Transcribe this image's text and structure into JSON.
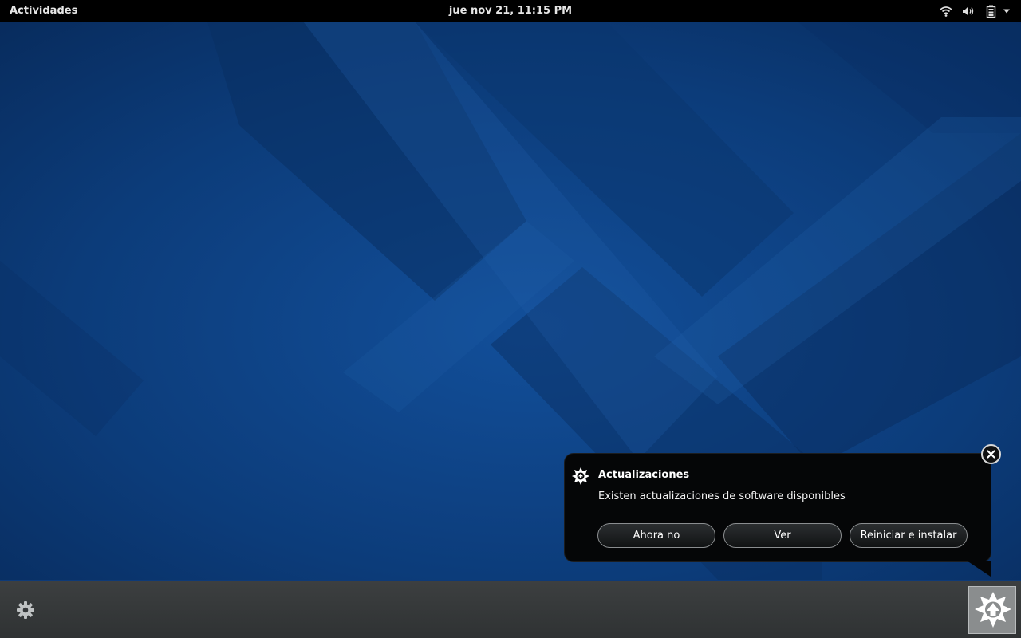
{
  "topbar": {
    "activities_label": "Actividades",
    "clock": "jue nov 21, 11:15 PM",
    "icons": [
      "wifi-icon",
      "volume-icon",
      "battery-icon",
      "menu-arrow-icon"
    ]
  },
  "notification": {
    "icon": "updates-icon",
    "title": "Actualizaciones",
    "body": "Existen actualizaciones de software disponibles",
    "buttons": {
      "not_now": "Ahora no",
      "view": "Ver",
      "restart_install": "Reiniciar e instalar"
    },
    "close_icon": "close-icon"
  },
  "message_tray": {
    "settings_icon": "gear-icon",
    "source_icon": "software-update-icon"
  },
  "colors": {
    "wallpaper_base": "#0d3a78",
    "topbar": "#000000",
    "notification_bg": "#050607",
    "tray_bg": "#35383a"
  }
}
